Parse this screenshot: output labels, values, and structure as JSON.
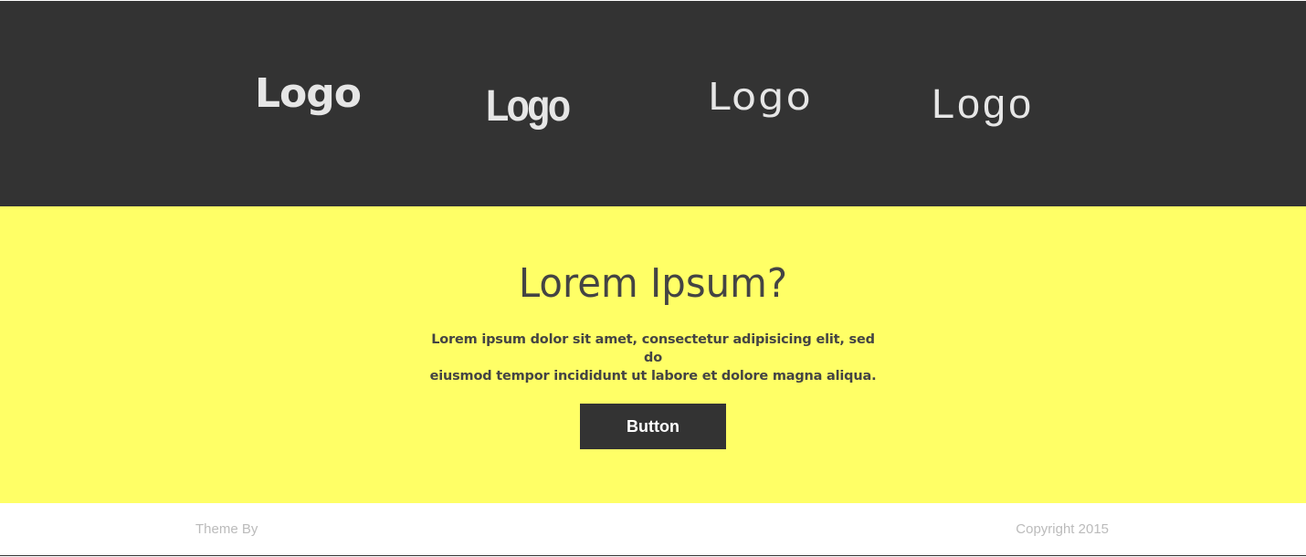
{
  "logos": {
    "items": [
      "Logo",
      "Logo",
      "Logo",
      "Logo"
    ]
  },
  "cta": {
    "title": "Lorem Ipsum?",
    "text_line_1": "Lorem ipsum dolor sit amet, consectetur adipisicing elit, sed do",
    "text_line_2": "eiusmod tempor incididunt ut labore et dolore magna aliqua.",
    "button_label": "Button"
  },
  "footer": {
    "left_text": "Theme By",
    "right_text": "Copyright 2015"
  },
  "colors": {
    "dark_band": "#333333",
    "accent_yellow": "#ffff66",
    "logo_text": "#e6e6e6",
    "body_text": "#444444",
    "footer_text": "#bbbbbb"
  }
}
